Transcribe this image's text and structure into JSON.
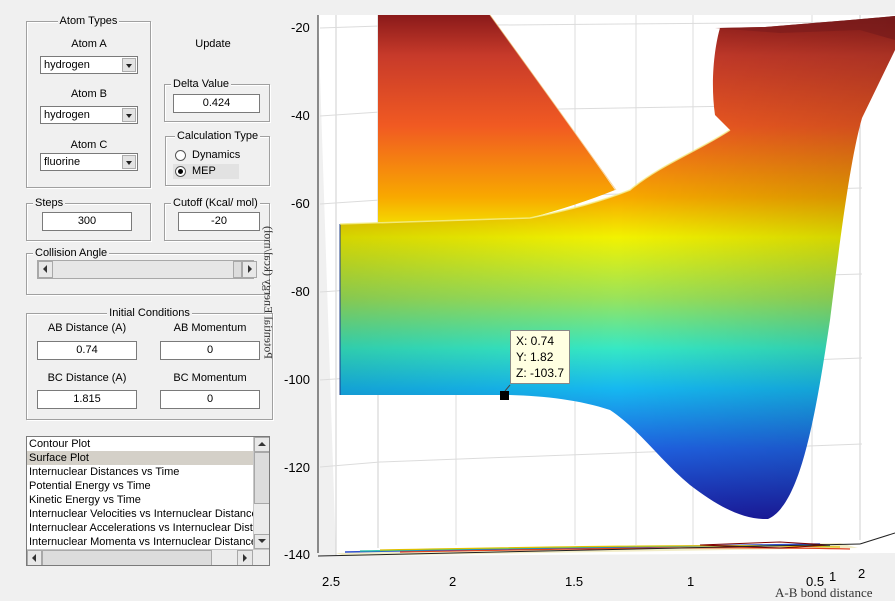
{
  "atom_types": {
    "title": "Atom Types",
    "atom_a": {
      "label": "Atom A",
      "value": "hydrogen"
    },
    "atom_b": {
      "label": "Atom B",
      "value": "hydrogen"
    },
    "atom_c": {
      "label": "Atom C",
      "value": "fluorine"
    }
  },
  "update_label": "Update",
  "delta": {
    "title": "Delta Value",
    "value": "0.424"
  },
  "calc_type": {
    "title": "Calculation Type",
    "options": [
      "Dynamics",
      "MEP"
    ],
    "selected": "MEP"
  },
  "steps": {
    "title": "Steps",
    "value": "300"
  },
  "cutoff": {
    "title": "Cutoff (Kcal/ mol)",
    "value": "-20"
  },
  "collision": {
    "title": "Collision Angle"
  },
  "initial": {
    "title": "Initial Conditions",
    "ab_distance": {
      "label": "AB Distance (A)",
      "value": "0.74"
    },
    "ab_momentum": {
      "label": "AB Momentum",
      "value": "0"
    },
    "bc_distance": {
      "label": "BC Distance (A)",
      "value": "1.815"
    },
    "bc_momentum": {
      "label": "BC Momentum",
      "value": "0"
    }
  },
  "plot_list": {
    "items": [
      "Contour Plot",
      "Surface Plot",
      "Internuclear Distances vs Time",
      "Potential Energy vs Time",
      "Kinetic Energy vs Time",
      "Internuclear Velocities vs Internuclear Distance",
      "Internuclear Accelerations vs Internuclear Dista",
      "Internuclear Momenta vs Internuclear Distance"
    ],
    "selected": "Surface Plot"
  },
  "chart_data": {
    "type": "surface",
    "zlabel": "Potential Energy (kcal/mol)",
    "xlabel": "A-B bond distance",
    "z_ticks": [
      "-20",
      "-40",
      "-60",
      "-80",
      "-100",
      "-120",
      "-140"
    ],
    "x_ticks": [
      "2.5",
      "2",
      "1.5",
      "1",
      "0.5"
    ],
    "y_ticks": [
      "1",
      "2"
    ],
    "zlim": [
      -140,
      -20
    ],
    "datatip": {
      "x": "X: 0.74",
      "y": "Y: 1.82",
      "z": "Z: -103.7"
    }
  },
  "colors": {
    "background": "#f0f0f0",
    "plot_bg": "#ffffff"
  }
}
